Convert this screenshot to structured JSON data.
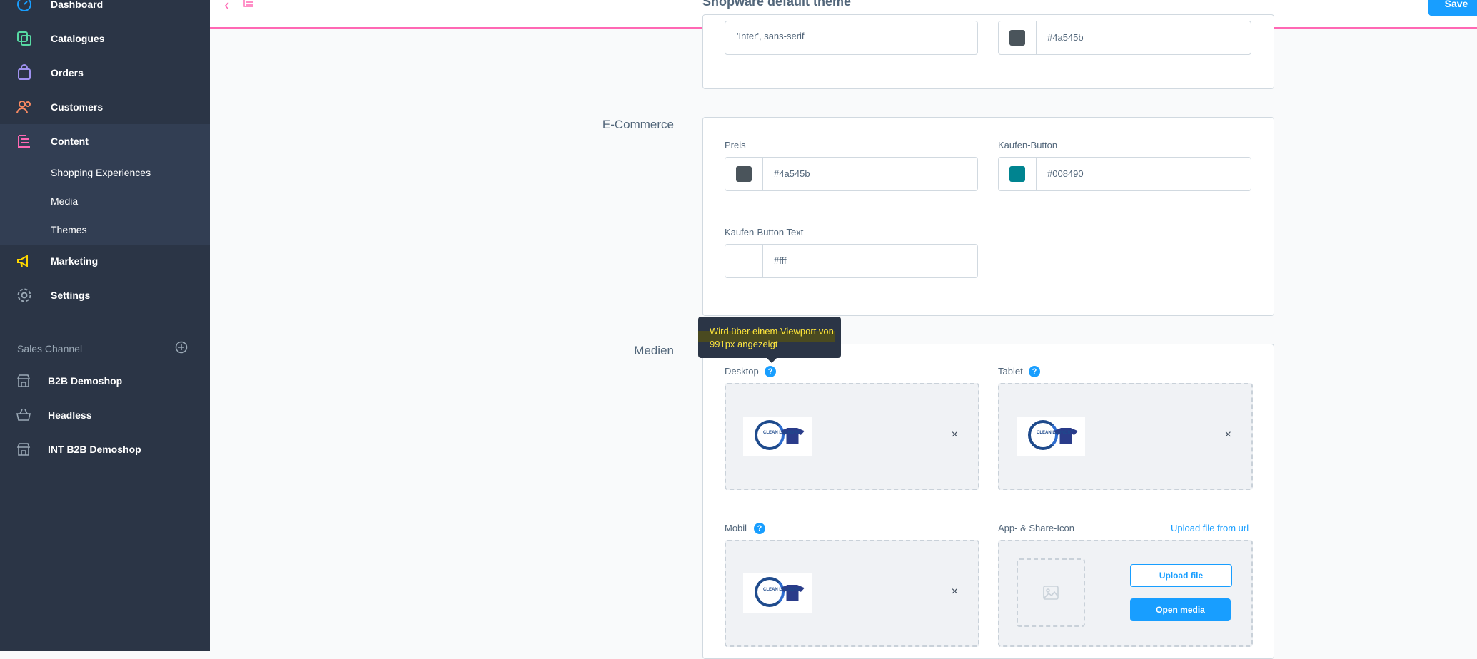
{
  "sidebar": {
    "items": [
      {
        "label": "Dashboard",
        "icon": "dashboard-icon",
        "color": "#189eff"
      },
      {
        "label": "Catalogues",
        "icon": "catalogue-icon",
        "color": "#57d9a3"
      },
      {
        "label": "Orders",
        "icon": "orders-icon",
        "color": "#a092f0"
      },
      {
        "label": "Customers",
        "icon": "customers-icon",
        "color": "#f88962"
      },
      {
        "label": "Content",
        "icon": "content-icon",
        "color": "#ff68b4"
      },
      {
        "label": "Marketing",
        "icon": "marketing-icon",
        "color": "#ffd700"
      },
      {
        "label": "Settings",
        "icon": "settings-icon",
        "color": "#9aa8b5"
      }
    ],
    "content_sub": [
      "Shopping Experiences",
      "Media",
      "Themes"
    ],
    "sales_channel_title": "Sales Channel",
    "sales_channels": [
      "B2B Demoshop",
      "Headless",
      "INT B2B Demoshop"
    ]
  },
  "topbar": {
    "title": "Shopware default theme",
    "save_label": "Save"
  },
  "typography": {
    "font_value": "'Inter', sans-serif",
    "color_value": "#4a545b",
    "color_swatch": "#4a545b"
  },
  "ecommerce": {
    "section_label": "E-Commerce",
    "fields": [
      {
        "label": "Preis",
        "value": "#4a545b",
        "swatch": "#4a545b"
      },
      {
        "label": "Kaufen-Button",
        "value": "#008490",
        "swatch": "#008490"
      },
      {
        "label": "Kaufen-Button Text",
        "value": "#fff",
        "swatch": "#ffffff"
      }
    ]
  },
  "media": {
    "section_label": "Medien",
    "tooltip": "Wird über einem Viewport von 991px angezeigt",
    "desktop_label": "Desktop",
    "tablet_label": "Tablet",
    "mobile_label": "Mobil",
    "app_icon_label": "App- & Share-Icon",
    "upload_url_link": "Upload file from url",
    "upload_file_label": "Upload file",
    "open_media_label": "Open media",
    "help_glyph": "?",
    "remove_glyph": "×",
    "logo_text": "CLEAN LAUNDRY"
  }
}
